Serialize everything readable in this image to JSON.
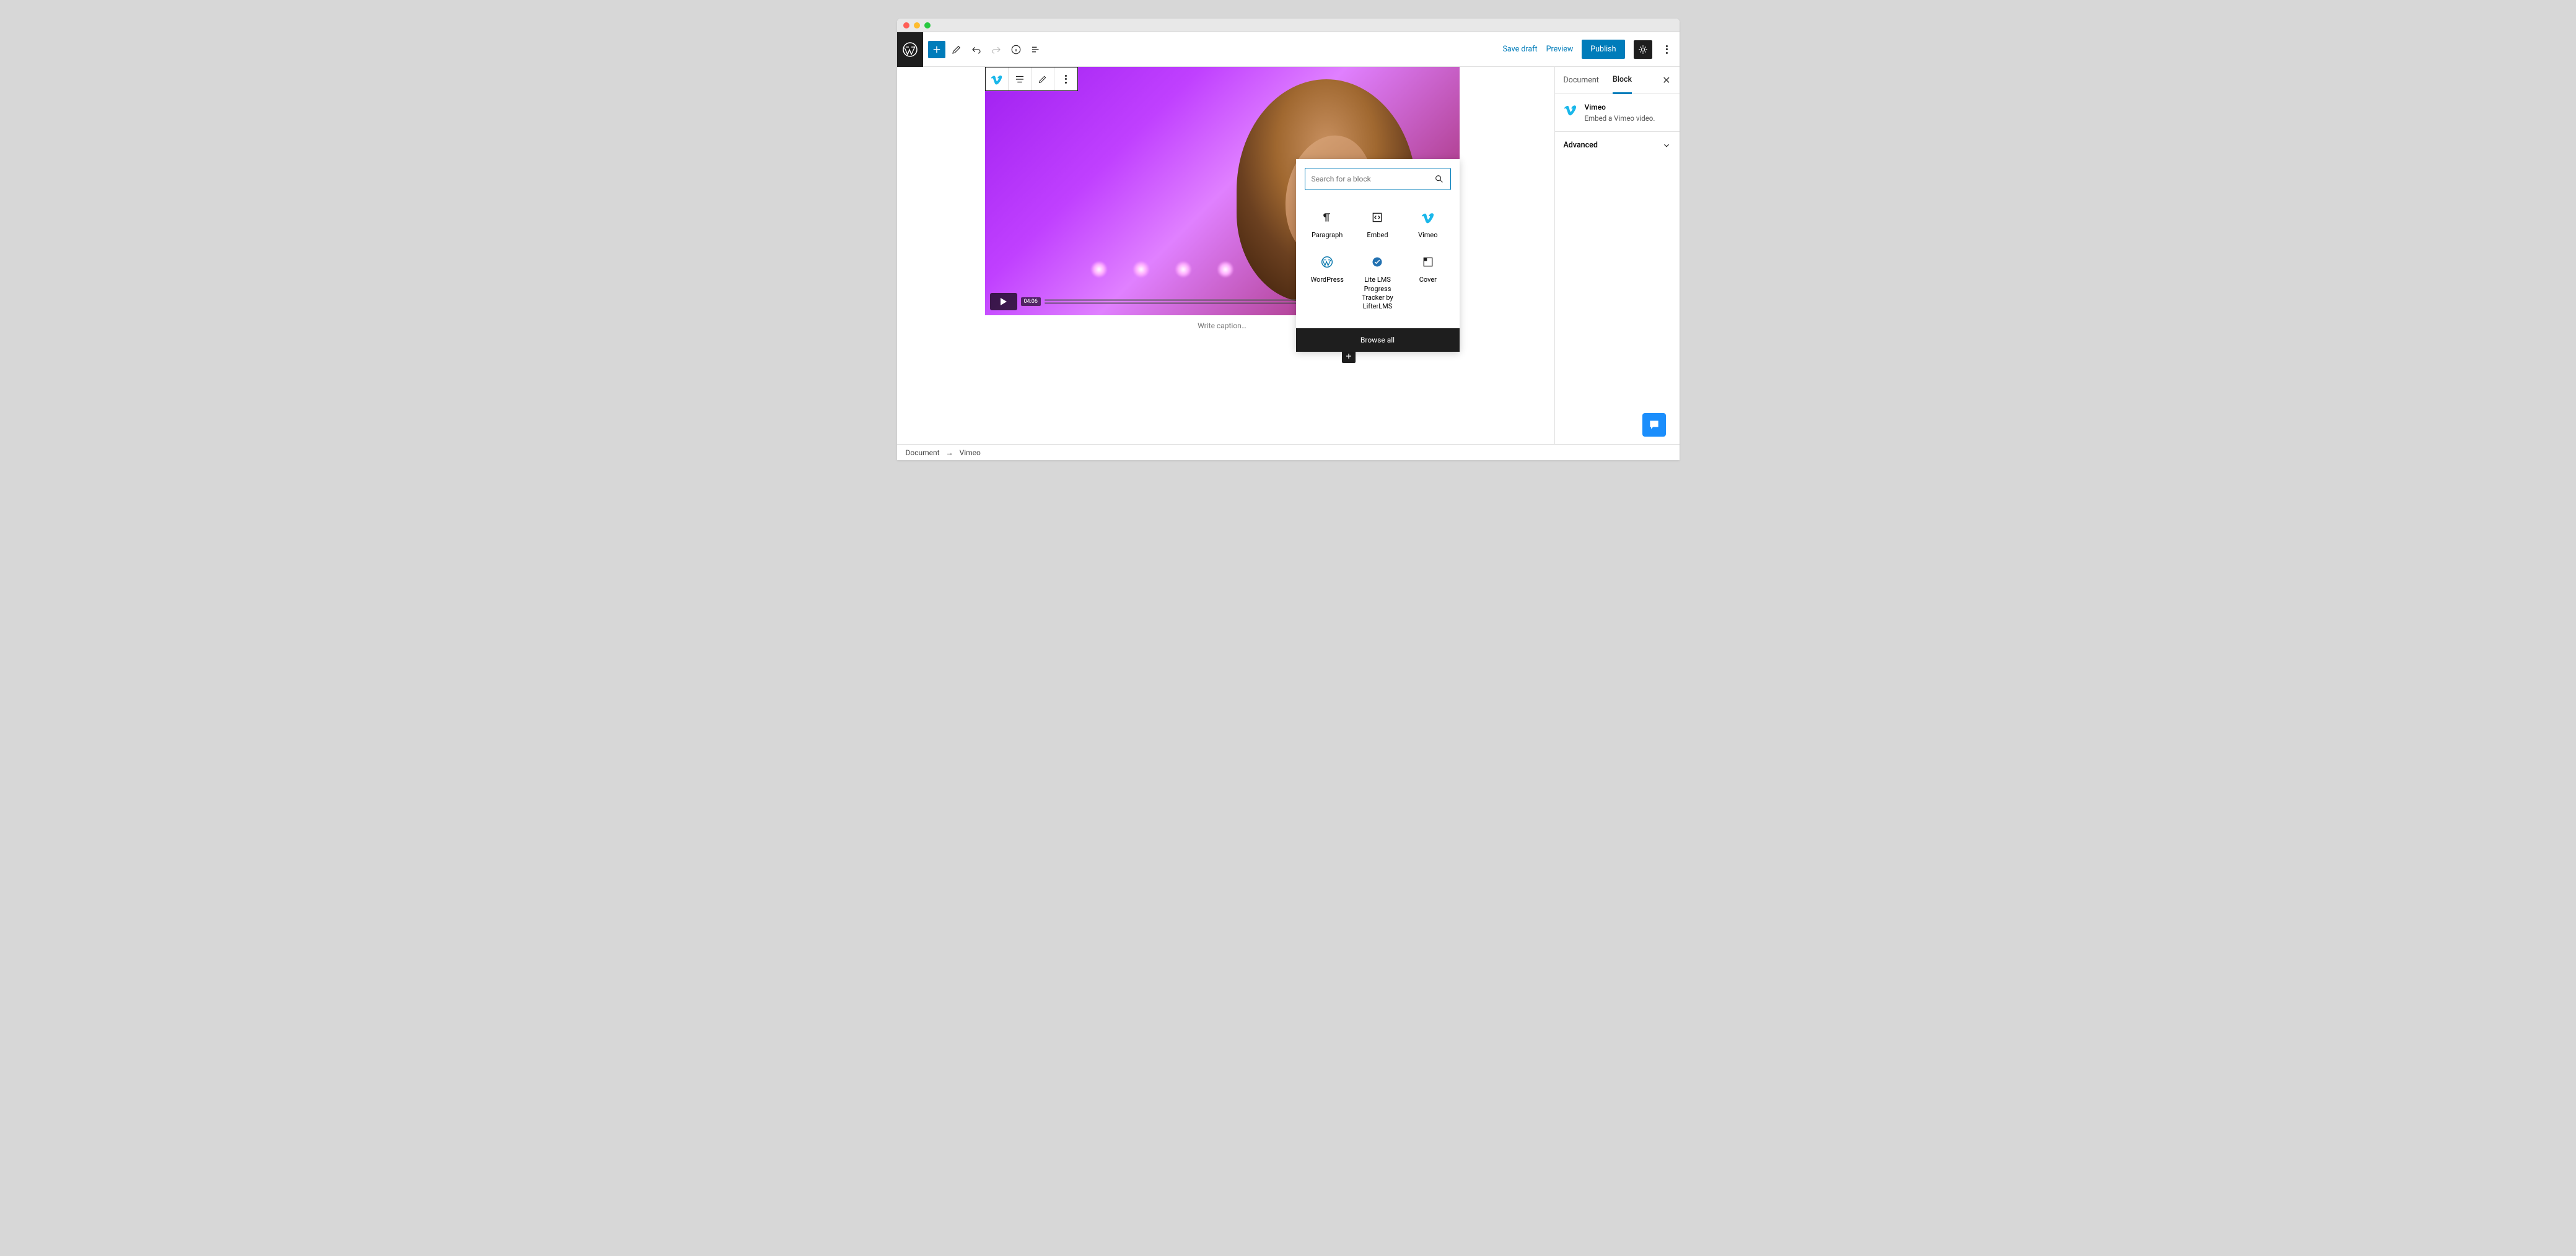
{
  "topbar": {
    "save_draft": "Save draft",
    "preview": "Preview",
    "publish": "Publish"
  },
  "block_toolbar": {
    "block_type": "vimeo"
  },
  "video": {
    "duration": "04:06",
    "caption_placeholder": "Write caption…"
  },
  "inserter": {
    "search_placeholder": "Search for a block",
    "blocks": [
      {
        "label": "Paragraph"
      },
      {
        "label": "Embed"
      },
      {
        "label": "Vimeo"
      },
      {
        "label": "WordPress"
      },
      {
        "label": "Lite LMS Progress Tracker by LifterLMS"
      },
      {
        "label": "Cover"
      }
    ],
    "browse_all": "Browse all"
  },
  "sidebar": {
    "tabs": {
      "document": "Document",
      "block": "Block"
    },
    "block_info": {
      "title": "Vimeo",
      "desc": "Embed a Vimeo video."
    },
    "advanced": "Advanced"
  },
  "breadcrumb": {
    "root": "Document",
    "current": "Vimeo"
  }
}
